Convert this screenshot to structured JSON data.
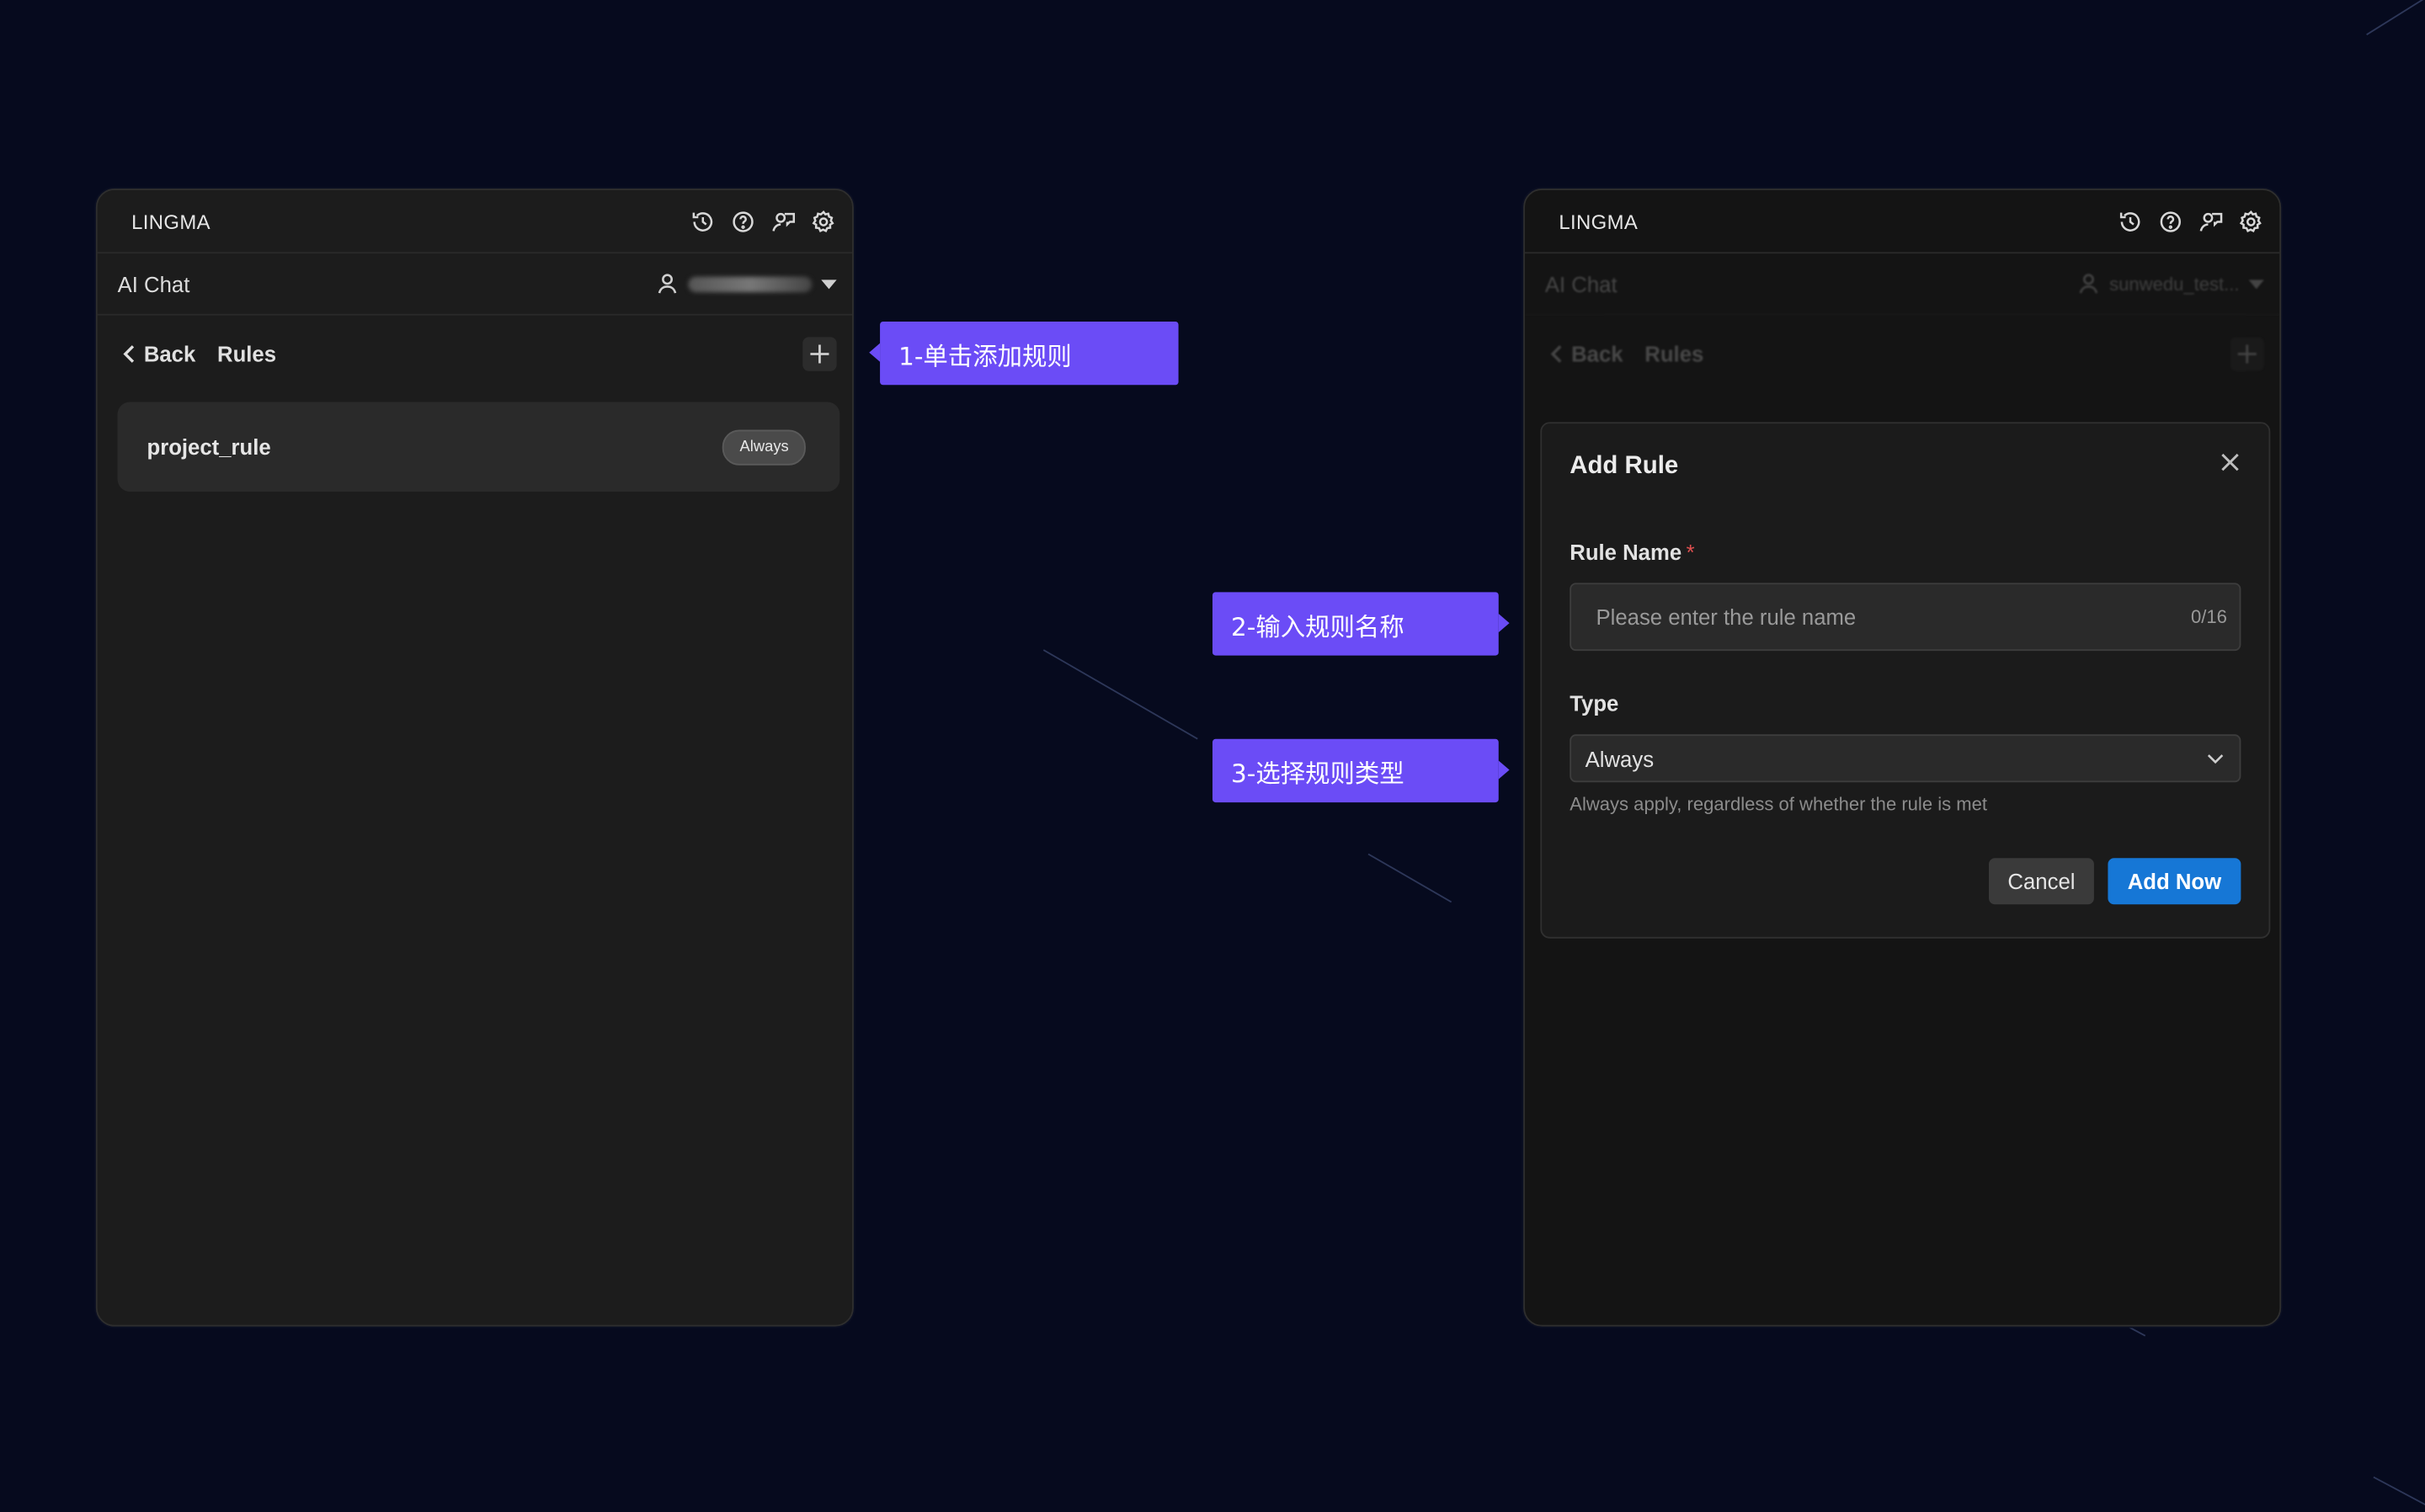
{
  "colors": {
    "background": "#060a1e",
    "panel": "#1c1c1c",
    "callout": "#6b4cf6",
    "primary_button": "#1677d6",
    "required_star": "#e05050"
  },
  "left_panel": {
    "brand": "LINGMA",
    "toolbar_icons": [
      "history-icon",
      "help-icon",
      "feedback-icon",
      "settings-icon"
    ],
    "chat_title": "AI Chat",
    "back_label": "Back",
    "rules_title": "Rules",
    "rules": [
      {
        "name": "project_rule",
        "badge": "Always"
      }
    ]
  },
  "right_panel": {
    "brand": "LINGMA",
    "chat_title": "AI Chat",
    "user_name": "sunwedu_test...",
    "back_label": "Back",
    "rules_title": "Rules",
    "dialog": {
      "title": "Add Rule",
      "name_label": "Rule Name",
      "required_mark": "*",
      "name_placeholder": "Please enter the rule name",
      "name_value": "",
      "counter": "0/16",
      "type_label": "Type",
      "type_selected": "Always",
      "type_hint": "Always apply, regardless of whether the rule is met",
      "cancel_label": "Cancel",
      "submit_label": "Add Now"
    }
  },
  "callouts": {
    "step1": "1-单击添加规则",
    "step2": "2-输入规则名称",
    "step3": "3-选择规则类型"
  }
}
